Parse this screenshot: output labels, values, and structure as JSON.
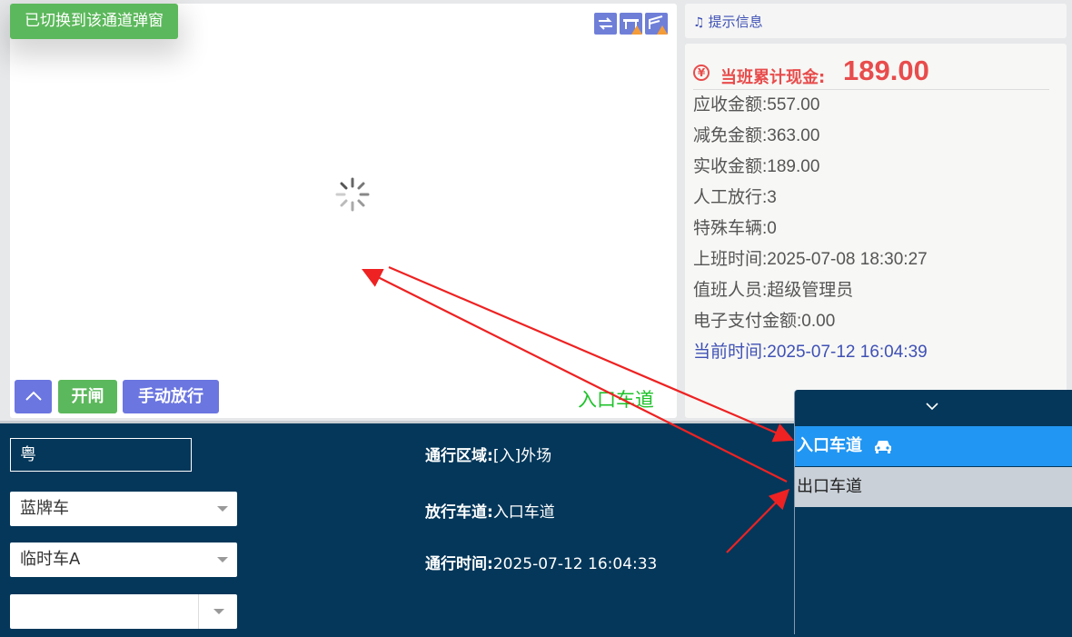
{
  "toast": {
    "text": "已切换到该通道弹窗"
  },
  "video": {
    "buttons": {
      "up_icon": "chevron-up-icon",
      "open": "开闸",
      "manual": "手动放行"
    },
    "lane_label": "入口车道"
  },
  "tip": {
    "label": "提示信息"
  },
  "shift": {
    "cash_label": "当班累计现金:",
    "cash_value": "189.00",
    "rows": [
      {
        "text": "应收金额:557.00"
      },
      {
        "text": "减免金额:363.00"
      },
      {
        "text": "实收金额:189.00"
      },
      {
        "text": "人工放行:3"
      },
      {
        "text": "特殊车辆:0"
      },
      {
        "text": "上班时间:2025-07-08 18:30:27"
      },
      {
        "text": "值班人员:超级管理员"
      },
      {
        "text": "电子支付金额:0.00"
      },
      {
        "text": "当前时间:2025-07-12 16:04:39"
      }
    ]
  },
  "form": {
    "plate_prefix": "粤",
    "plate_color": "蓝牌车",
    "vehicle_type": "临时车A",
    "extra_value": ""
  },
  "details": {
    "area_label": "通行区域:",
    "area_value": "[入]外场",
    "lane_label": "放行车道:",
    "lane_value": "入口车道",
    "time_label": "通行时间:",
    "time_value": "2025-07-12 16:04:33"
  },
  "lanes": {
    "items": [
      {
        "label": "入口车道",
        "active": true
      },
      {
        "label": "出口车道",
        "active": false
      }
    ]
  },
  "colors": {
    "accent": "#6b76e0",
    "success": "#5cb85c",
    "danger": "#e84c4c",
    "panel": "#04375a",
    "active_lane": "#2196f3"
  }
}
